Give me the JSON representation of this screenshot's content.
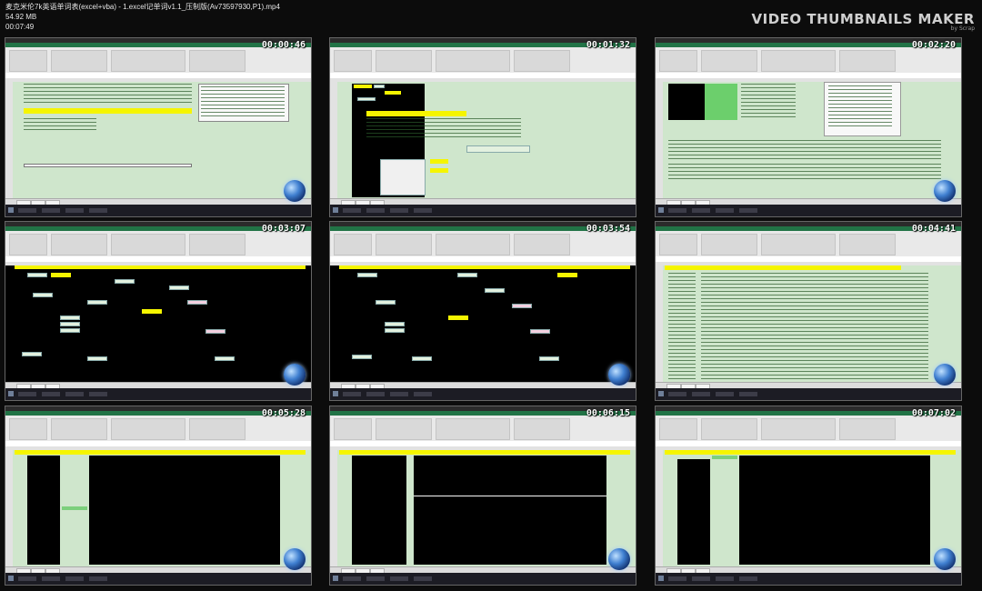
{
  "file": {
    "title": "麦克米伦7k英语单词表(excel+vba) - 1.excel记单词v1.1_压制版(Av73597930,P1).mp4",
    "size": "54.92 MB",
    "duration": "00:07:49"
  },
  "brand": {
    "name": "VIDEO THUMBNAILS MAKER",
    "byline": "by Scrap"
  },
  "thumbnails": [
    {
      "timestamp": "00:00:46"
    },
    {
      "timestamp": "00:01:32"
    },
    {
      "timestamp": "00:02:20"
    },
    {
      "timestamp": "00:03:07"
    },
    {
      "timestamp": "00:03:54"
    },
    {
      "timestamp": "00:04:41"
    },
    {
      "timestamp": "00:05:28"
    },
    {
      "timestamp": "00:06:15"
    },
    {
      "timestamp": "00:07:02"
    }
  ],
  "colors": {
    "background": "#0c0c0c",
    "sheet_green": "#cfe6cc",
    "highlight_yellow": "#f5f500",
    "excel_green": "#217346"
  }
}
